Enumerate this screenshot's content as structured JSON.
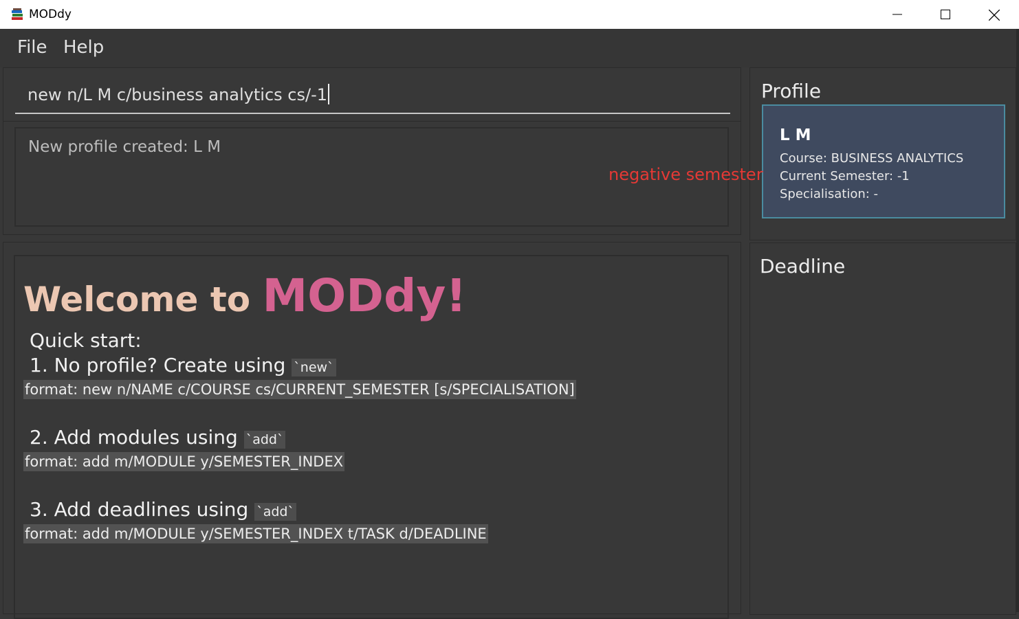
{
  "window": {
    "title": "MODdy"
  },
  "menu": {
    "file": "File",
    "help": "Help"
  },
  "command": {
    "value": "new n/L M c/business analytics cs/-1"
  },
  "result": {
    "text": "New profile created: L M"
  },
  "welcome": {
    "title_prefix": "Welcome to ",
    "title_brand": "MODdy!",
    "quick_start": "Quick start:",
    "step1": {
      "label": "1. No profile? Create using ",
      "command": "`new`",
      "format": "format: new n/NAME c/COURSE cs/CURRENT_SEMESTER [s/SPECIALISATION]"
    },
    "step2": {
      "label": "2. Add modules using ",
      "command": "`add`",
      "format": "format: add m/MODULE y/SEMESTER_INDEX"
    },
    "step3": {
      "label": "3. Add deadlines using ",
      "command": "`add`",
      "format": "format: add m/MODULE y/SEMESTER_INDEX t/TASK d/DEADLINE"
    }
  },
  "profile": {
    "heading": "Profile",
    "name": "L M",
    "course": "Course: BUSINESS ANALYTICS",
    "semester": "Current Semester: -1",
    "specialisation": "Specialisation: -"
  },
  "deadline": {
    "heading": "Deadline"
  },
  "annotation": {
    "text": "negative semester"
  },
  "colors": {
    "accent_brand": "#d46290",
    "welcome_text": "#ecc7b2",
    "card_bg": "#3f4a5f",
    "card_border": "#4a8ca0",
    "annotation": "#e53935"
  },
  "icons": [
    "app-books-icon",
    "minimize-icon",
    "maximize-icon",
    "close-icon"
  ]
}
